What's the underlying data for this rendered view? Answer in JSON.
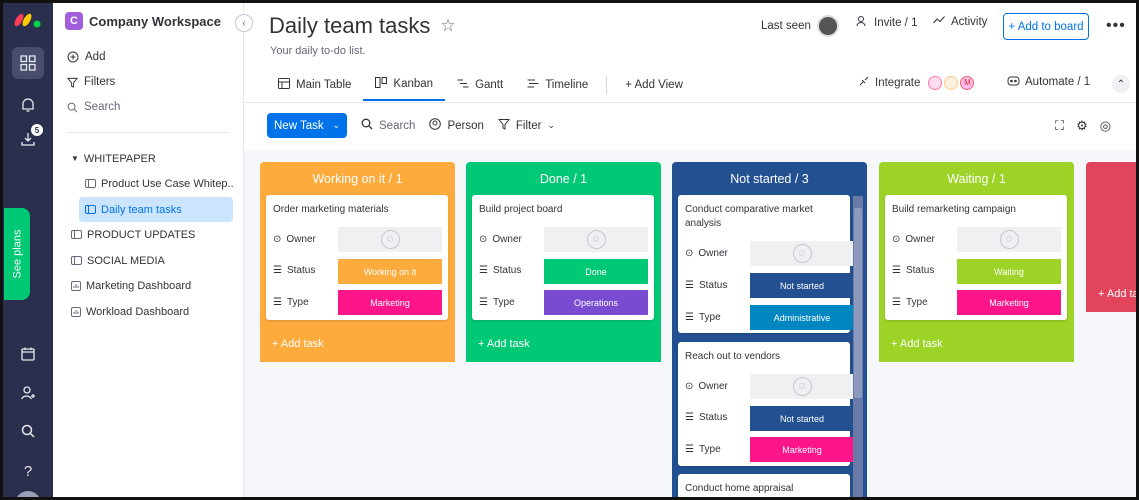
{
  "workspace": {
    "logo_letter": "C",
    "name": "Company Workspace",
    "add_label": "Add",
    "filters_label": "Filters",
    "search_label": "Search",
    "nav": [
      {
        "label": "WHITEPAPER"
      },
      {
        "label": "Product Use Case Whitep..."
      },
      {
        "label": "Daily team tasks"
      },
      {
        "label": "PRODUCT UPDATES"
      },
      {
        "label": "SOCIAL MEDIA"
      },
      {
        "label": "Marketing Dashboard"
      },
      {
        "label": "Workload Dashboard"
      }
    ]
  },
  "rail": {
    "inbox_badge": "5",
    "see_plans": "See plans"
  },
  "header": {
    "title": "Daily team tasks",
    "subtitle": "Your daily to-do list.",
    "last_seen": "Last seen",
    "invite": "Invite / 1",
    "activity": "Activity",
    "add_to_board": "+ Add to board",
    "more": "•••"
  },
  "tabs": [
    {
      "label": "Main Table"
    },
    {
      "label": "Kanban"
    },
    {
      "label": "Gantt"
    },
    {
      "label": "Timeline"
    }
  ],
  "add_view": "+ Add View",
  "integrate": "Integrate",
  "automate": "Automate / 1",
  "toolbar": {
    "new_task": "New Task",
    "search": "Search",
    "person": "Person",
    "filter": "Filter"
  },
  "columns": [
    {
      "title": "Working on it / 1",
      "color": "#fdab3d",
      "add_task": "+ Add task",
      "cards": [
        {
          "title": "Order marketing materials",
          "status": "Working on it",
          "status_color": "#fdab3d",
          "type": "Marketing",
          "type_color": "#ff158a"
        }
      ]
    },
    {
      "title": "Done / 1",
      "color": "#00c875",
      "add_task": "+ Add task",
      "cards": [
        {
          "title": "Build project board",
          "status": "Done",
          "status_color": "#00c875",
          "type": "Operations",
          "type_color": "#784bd1"
        }
      ]
    },
    {
      "title": "Not started / 3",
      "color": "#225091",
      "cards": [
        {
          "title": "Conduct comparative market analysis",
          "status": "Not started",
          "status_color": "#225091",
          "type": "Administrative",
          "type_color": "#0086c0"
        },
        {
          "title": "Reach out to vendors",
          "status": "Not started",
          "status_color": "#225091",
          "type": "Marketing",
          "type_color": "#ff158a"
        },
        {
          "title": "Conduct home appraisal"
        }
      ]
    },
    {
      "title": "Waiting / 1",
      "color": "#9cd326",
      "add_task": "+ Add task",
      "cards": [
        {
          "title": "Build remarketing campaign",
          "status": "Waiting",
          "status_color": "#9cd326",
          "type": "Marketing",
          "type_color": "#ff158a"
        }
      ]
    },
    {
      "color": "#e2445c",
      "add_task": "+ Add tas"
    }
  ],
  "field_labels": {
    "owner": "Owner",
    "status": "Status",
    "type": "Type"
  }
}
